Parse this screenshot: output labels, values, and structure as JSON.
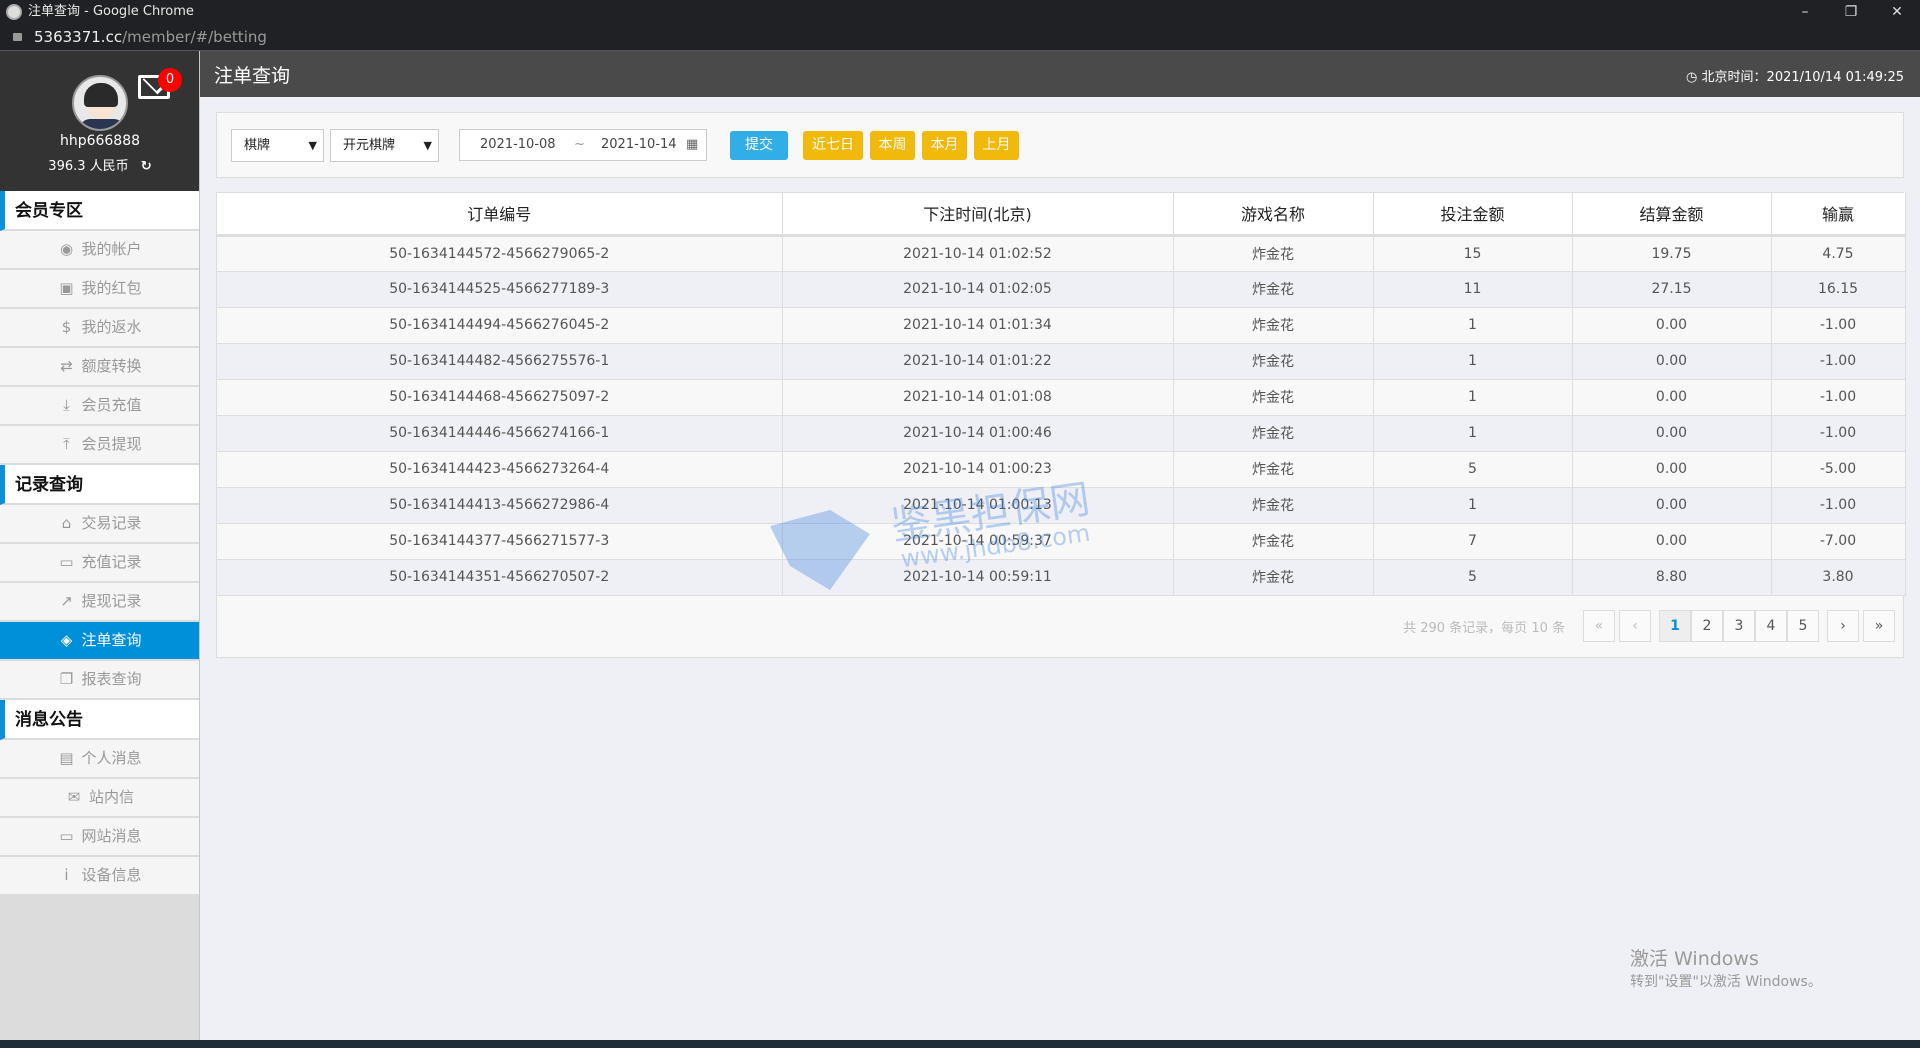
{
  "browser": {
    "title": "注单查询 - Google Chrome",
    "url_host": "5363371.cc",
    "url_path": "/member/#/betting"
  },
  "profile": {
    "username": "hhp666888",
    "balance": "396.3 人民币",
    "unread": "0"
  },
  "sidebar": [
    {
      "section": "会员专区",
      "items": [
        {
          "label": "我的帐户",
          "icon": "user-circle-icon"
        },
        {
          "label": "我的红包",
          "icon": "envelope-icon"
        },
        {
          "label": "我的返水",
          "icon": "dollar-icon"
        },
        {
          "label": "额度转换",
          "icon": "exchange-icon"
        },
        {
          "label": "会员充值",
          "icon": "download-icon"
        },
        {
          "label": "会员提现",
          "icon": "upload-icon"
        }
      ]
    },
    {
      "section": "记录查询",
      "items": [
        {
          "label": "交易记录",
          "icon": "bank-icon"
        },
        {
          "label": "充值记录",
          "icon": "credit-card-icon"
        },
        {
          "label": "提现记录",
          "icon": "line-chart-icon"
        },
        {
          "label": "注单查询",
          "icon": "ticket-icon",
          "active": true
        },
        {
          "label": "报表查询",
          "icon": "copy-icon"
        }
      ]
    },
    {
      "section": "消息公告",
      "items": [
        {
          "label": "个人消息",
          "icon": "id-card-icon"
        },
        {
          "label": "站内信",
          "icon": "envelope-o-icon"
        },
        {
          "label": "网站消息",
          "icon": "laptop-icon"
        },
        {
          "label": "设备信息",
          "icon": "info-icon"
        }
      ]
    }
  ],
  "header": {
    "title": "注单查询",
    "clock_label": "北京时间：",
    "clock": "2021/10/14 01:49:25"
  },
  "filter": {
    "category": "棋牌",
    "platform": "开元棋牌",
    "date_from": "2021-10-08",
    "date_sep": "~",
    "date_to": "2021-10-14",
    "submit": "提交",
    "last7": "近七日",
    "this_week": "本周",
    "this_month": "本月",
    "last_month": "上月"
  },
  "table": {
    "headers": [
      "订单编号",
      "下注时间(北京)",
      "游戏名称",
      "投注金额",
      "结算金额",
      "输赢"
    ],
    "rows": [
      [
        "50-1634144572-4566279065-2",
        "2021-10-14 01:02:52",
        "炸金花",
        "15",
        "19.75",
        "4.75"
      ],
      [
        "50-1634144525-4566277189-3",
        "2021-10-14 01:02:05",
        "炸金花",
        "11",
        "27.15",
        "16.15"
      ],
      [
        "50-1634144494-4566276045-2",
        "2021-10-14 01:01:34",
        "炸金花",
        "1",
        "0.00",
        "-1.00"
      ],
      [
        "50-1634144482-4566275576-1",
        "2021-10-14 01:01:22",
        "炸金花",
        "1",
        "0.00",
        "-1.00"
      ],
      [
        "50-1634144468-4566275097-2",
        "2021-10-14 01:01:08",
        "炸金花",
        "1",
        "0.00",
        "-1.00"
      ],
      [
        "50-1634144446-4566274166-1",
        "2021-10-14 01:00:46",
        "炸金花",
        "1",
        "0.00",
        "-1.00"
      ],
      [
        "50-1634144423-4566273264-4",
        "2021-10-14 01:00:23",
        "炸金花",
        "5",
        "0.00",
        "-5.00"
      ],
      [
        "50-1634144413-4566272986-4",
        "2021-10-14 01:00:13",
        "炸金花",
        "1",
        "0.00",
        "-1.00"
      ],
      [
        "50-1634144377-4566271577-3",
        "2021-10-14 00:59:37",
        "炸金花",
        "7",
        "0.00",
        "-7.00"
      ],
      [
        "50-1634144351-4566270507-2",
        "2021-10-14 00:59:11",
        "炸金花",
        "5",
        "8.80",
        "3.80"
      ]
    ]
  },
  "pagination": {
    "info": "共 290 条记录，每页 10 条",
    "first": "«",
    "prev": "‹",
    "pages": [
      "1",
      "2",
      "3",
      "4",
      "5"
    ],
    "current": "1",
    "next": "›",
    "last": "»"
  },
  "watermark": {
    "name": "鉴黑担保网",
    "url": "www.jhdb8.com"
  },
  "os": {
    "activate_title": "激活 Windows",
    "activate_hint": "转到\"设置\"以激活 Windows。"
  },
  "colors": {
    "accent": "#0090da",
    "submit": "#31aee6",
    "quick": "#f0b90b",
    "badge": "#ff0000"
  }
}
